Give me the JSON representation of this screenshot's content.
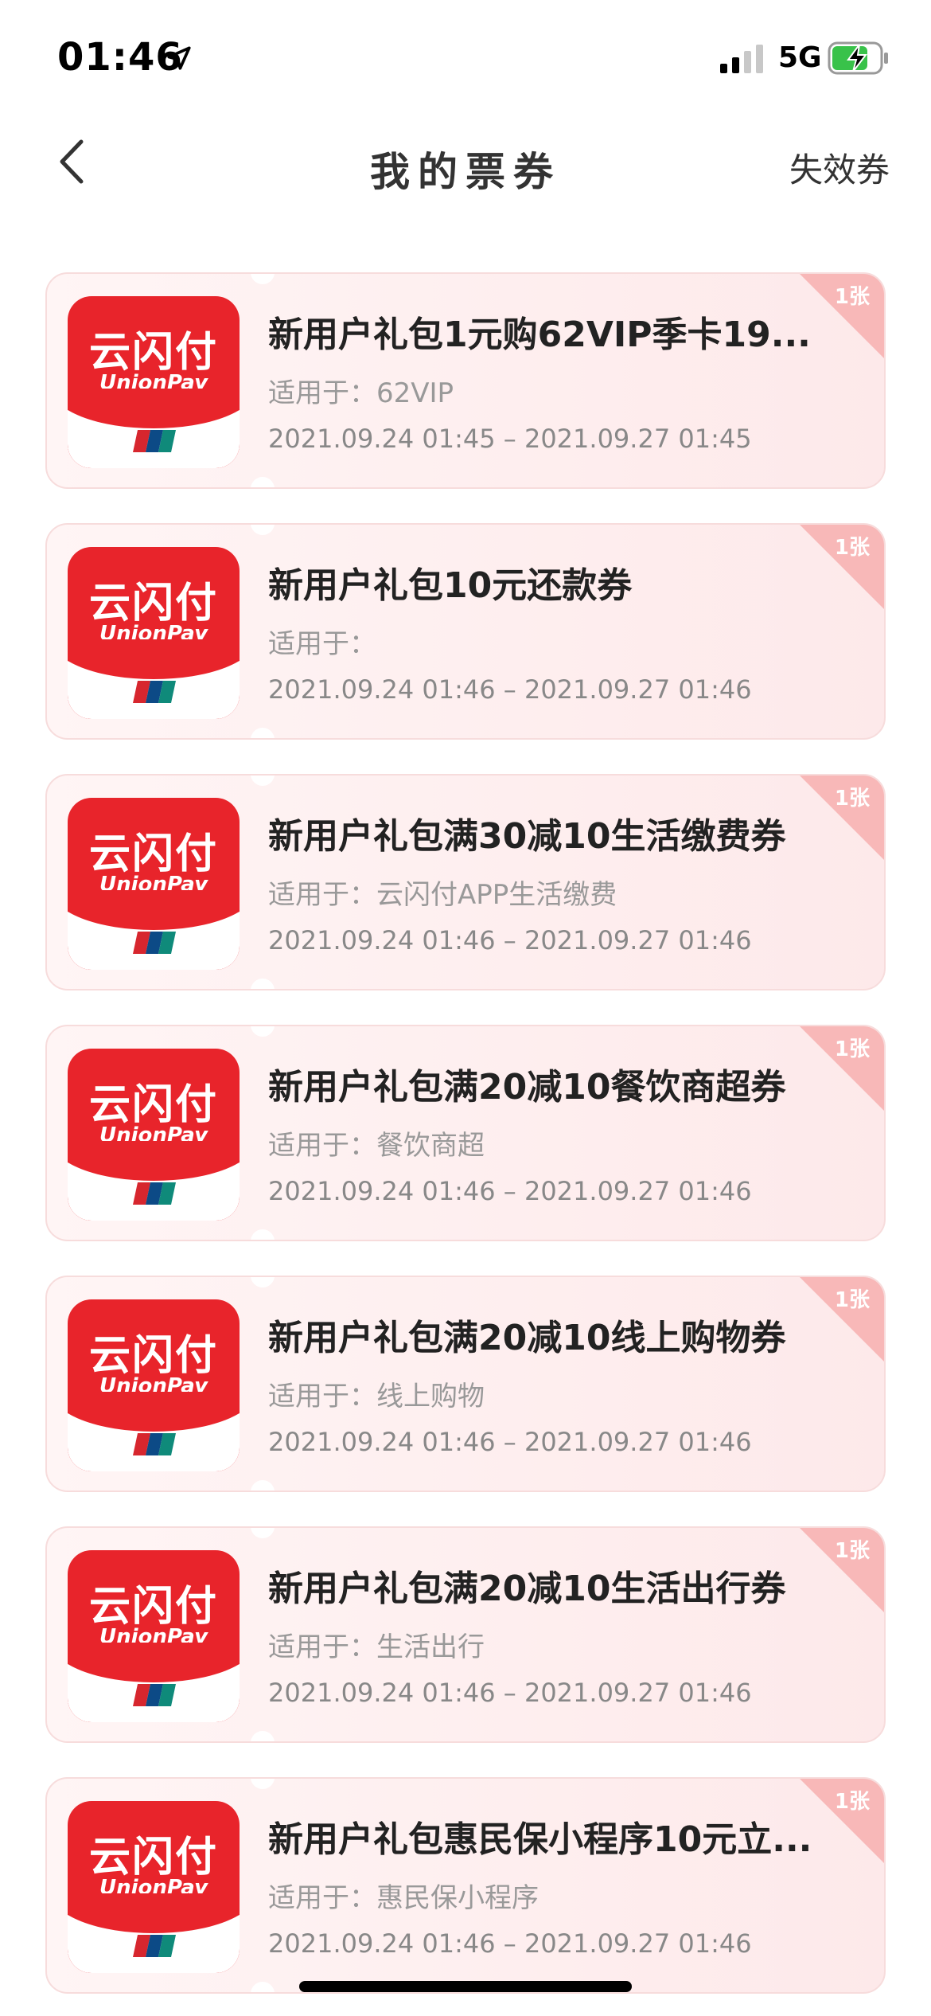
{
  "status_bar": {
    "time": "01:46",
    "network": "5G"
  },
  "nav": {
    "title": "我的票券",
    "right_action": "失效券"
  },
  "logo": {
    "name_cn": "云闪付",
    "name_en": "UnionPay"
  },
  "coupons": [
    {
      "title": "新用户礼包1元购62VIP季卡19...",
      "scope": "适用于：62VIP",
      "period": "2021.09.24 01:45 – 2021.09.27 01:45",
      "count": "1张"
    },
    {
      "title": "新用户礼包10元还款券",
      "scope": "适用于：",
      "period": "2021.09.24 01:46 – 2021.09.27 01:46",
      "count": "1张"
    },
    {
      "title": "新用户礼包满30减10生活缴费券",
      "scope": "适用于：云闪付APP生活缴费",
      "period": "2021.09.24 01:46 – 2021.09.27 01:46",
      "count": "1张"
    },
    {
      "title": "新用户礼包满20减10餐饮商超券",
      "scope": "适用于：餐饮商超",
      "period": "2021.09.24 01:46 – 2021.09.27 01:46",
      "count": "1张"
    },
    {
      "title": "新用户礼包满20减10线上购物券",
      "scope": "适用于：线上购物",
      "period": "2021.09.24 01:46 – 2021.09.27 01:46",
      "count": "1张"
    },
    {
      "title": "新用户礼包满20减10生活出行券",
      "scope": "适用于：生活出行",
      "period": "2021.09.24 01:46 – 2021.09.27 01:46",
      "count": "1张"
    },
    {
      "title": "新用户礼包惠民保小程序10元立...",
      "scope": "适用于：惠民保小程序",
      "period": "2021.09.24 01:46 – 2021.09.27 01:46",
      "count": "1张"
    }
  ],
  "colors": {
    "brand_red": "#e8242b",
    "card_bg": "#fdeeee",
    "badge_pink": "#f8b8b8"
  }
}
